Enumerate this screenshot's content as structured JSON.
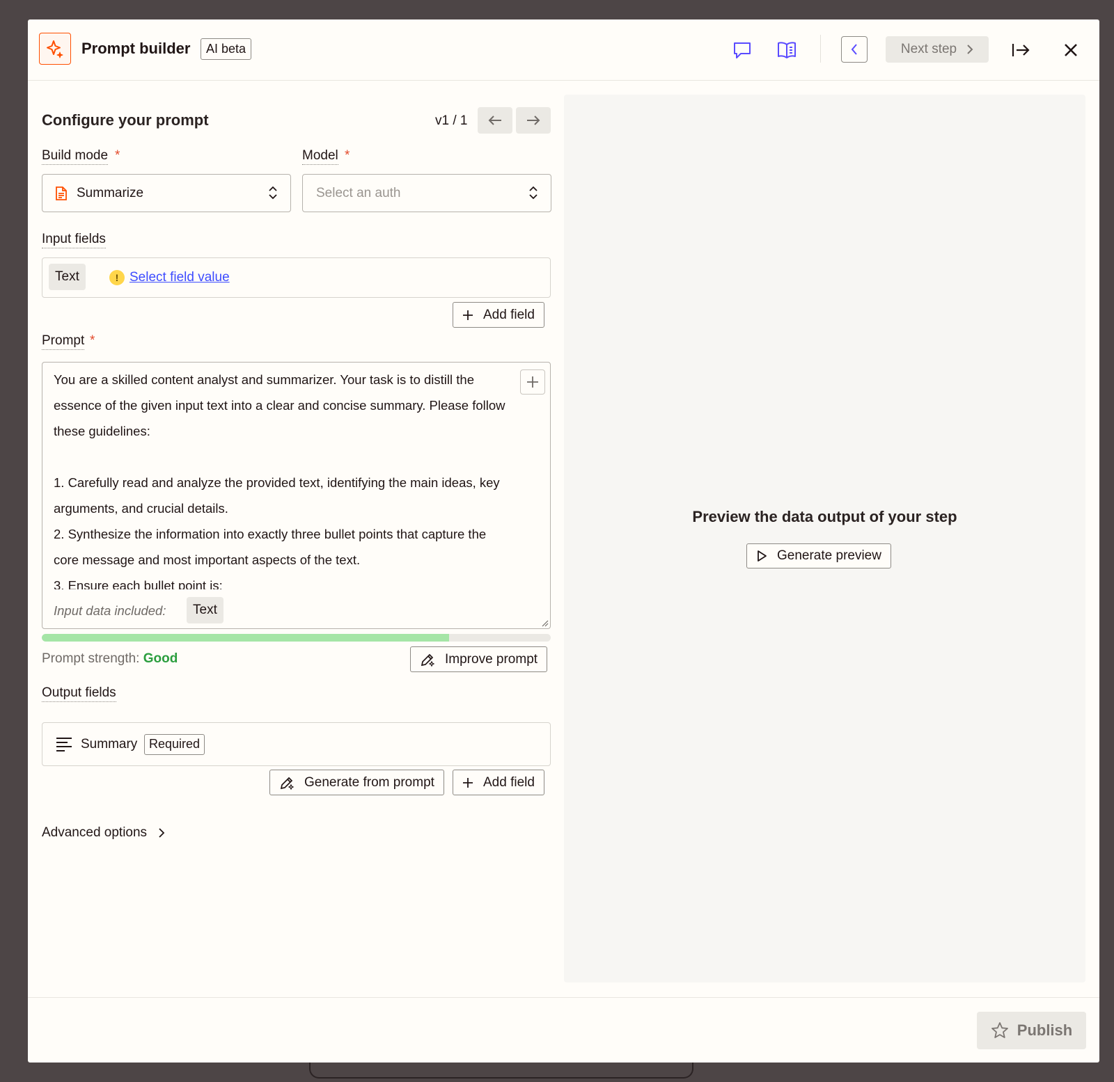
{
  "header": {
    "title": "Prompt builder",
    "badge": "AI beta",
    "next_step_label": "Next step"
  },
  "configure": {
    "title": "Configure your prompt",
    "version": "v1 / 1"
  },
  "build_mode": {
    "label": "Build mode",
    "value": "Summarize"
  },
  "model": {
    "label": "Model",
    "placeholder": "Select an auth"
  },
  "input_fields": {
    "label": "Input fields",
    "chip": "Text",
    "link": "Select field value",
    "add_field_label": "Add field"
  },
  "prompt": {
    "label": "Prompt",
    "text": "You are a skilled content analyst and summarizer. Your task is to distill the essence of the given input text into a clear and concise summary. Please follow these guidelines:\n\n1. Carefully read and analyze the provided text, identifying the main ideas, key arguments, and crucial details.\n2. Synthesize the information into exactly three bullet points that capture the core message and most important aspects of the text.\n3. Ensure each bullet point is:",
    "included_label": "Input data included:",
    "included_chip": "Text",
    "strength_label": "Prompt strength:",
    "strength_value": "Good",
    "strength_fraction": 0.8,
    "improve_label": "Improve prompt"
  },
  "output_fields": {
    "label": "Output fields",
    "field_name": "Summary",
    "field_badge": "Required",
    "generate_label": "Generate from prompt",
    "add_field_label": "Add field"
  },
  "advanced_label": "Advanced options",
  "preview": {
    "title": "Preview the data output of your step",
    "button_label": "Generate preview"
  },
  "footer": {
    "publish_label": "Publish"
  },
  "colors": {
    "brand": "#ff4f00",
    "link": "#3d4cff",
    "accent_icon": "#5a4bff",
    "required": "#e34b2c",
    "good": "#2b9e3e",
    "strength_bar": "#a5e5a6"
  },
  "icons": [
    "sparkle-icon",
    "chat-icon",
    "book-icon",
    "chevron-left-icon",
    "chevron-right-icon",
    "exit-panel-icon",
    "close-icon",
    "arrow-left-icon",
    "arrow-right-icon",
    "document-icon",
    "chevron-updown-icon",
    "warning-icon",
    "plus-icon",
    "resize-icon",
    "pencil-sparkle-icon",
    "lines-icon",
    "play-icon",
    "star-icon"
  ]
}
